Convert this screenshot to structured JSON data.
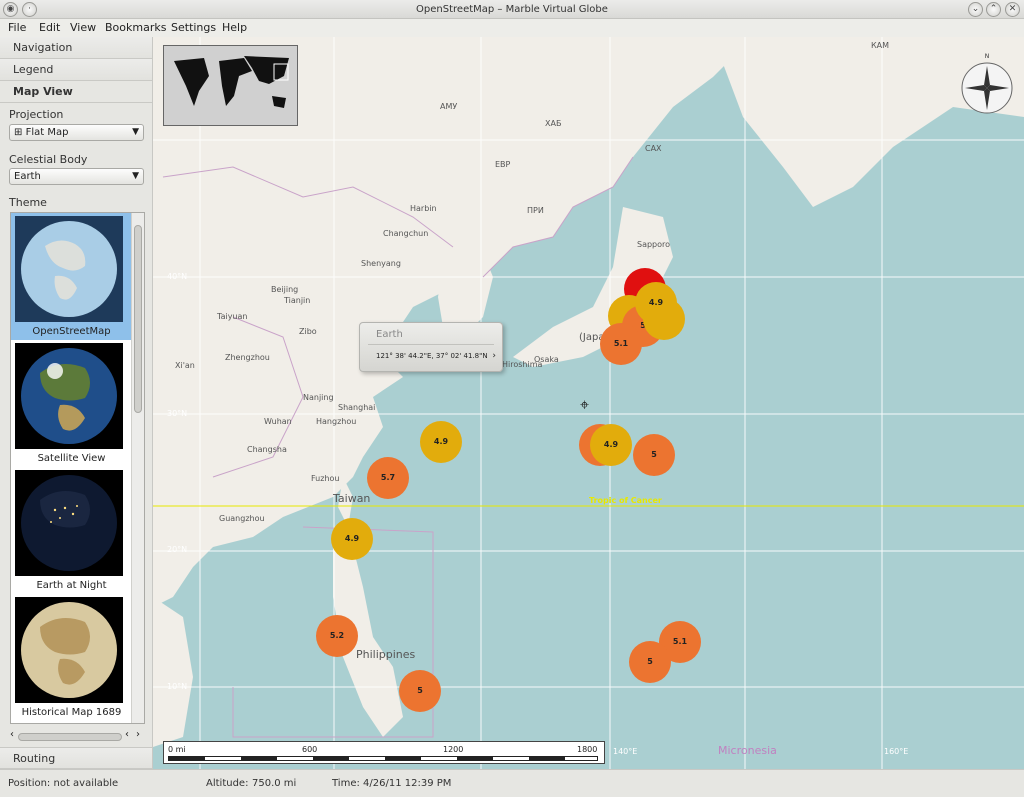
{
  "window": {
    "title": "OpenStreetMap – Marble Virtual Globe"
  },
  "menu": [
    "File",
    "Edit",
    "View",
    "Bookmarks",
    "Settings",
    "Help"
  ],
  "side": {
    "tabs": {
      "navigation": "Navigation",
      "legend": "Legend",
      "map_view": "Map View",
      "routing": "Routing"
    },
    "projection_label": "Projection",
    "projection_value": "Flat Map",
    "celestial_label": "Celestial Body",
    "celestial_value": "Earth",
    "theme_label": "Theme",
    "themes": [
      "OpenStreetMap",
      "Satellite View",
      "Earth at Night",
      "Historical Map 1689"
    ]
  },
  "map": {
    "popup": {
      "title": "Earth",
      "coords": "121° 38' 44.2\"E,  37° 02' 41.8\"N"
    },
    "tropic": "Tropic of Cancer",
    "scale": {
      "labels": [
        "0 mi",
        "600",
        "1200",
        "1800"
      ]
    },
    "cities": [
      "Sapporo",
      "Harbin",
      "Changchun",
      "Shenyang",
      "Beijing",
      "Tianjin",
      "Taiyuan",
      "Zhengzhou",
      "Xi'an",
      "Wuhan",
      "Nanjing",
      "Shanghai",
      "Hangzhou",
      "Changsha",
      "Guangzhou",
      "Fuzhou",
      "Taiwan",
      "Zibo",
      "Osaka",
      "Hiroshima",
      "Philippines",
      "Micronesia",
      "ХАБ",
      "АМУ",
      "САХ",
      "ЕВР",
      "ПРИ",
      "КАМ",
      "(Japan)"
    ],
    "markers": [
      "4.9",
      "5",
      "5.1",
      "4.9",
      "4.9",
      "5",
      "4.9",
      "5.7",
      "4.9",
      "5.2",
      "5.1",
      "5",
      "5"
    ],
    "gridlabels": [
      "40°N",
      "30°N",
      "20°N",
      "10°N",
      "140°E",
      "160°E"
    ]
  },
  "status": {
    "position": "Position: not available",
    "altitude_label": "Altitude:",
    "altitude_value": "750.0 mi",
    "time": "Time: 4/26/11 12:39 PM"
  }
}
